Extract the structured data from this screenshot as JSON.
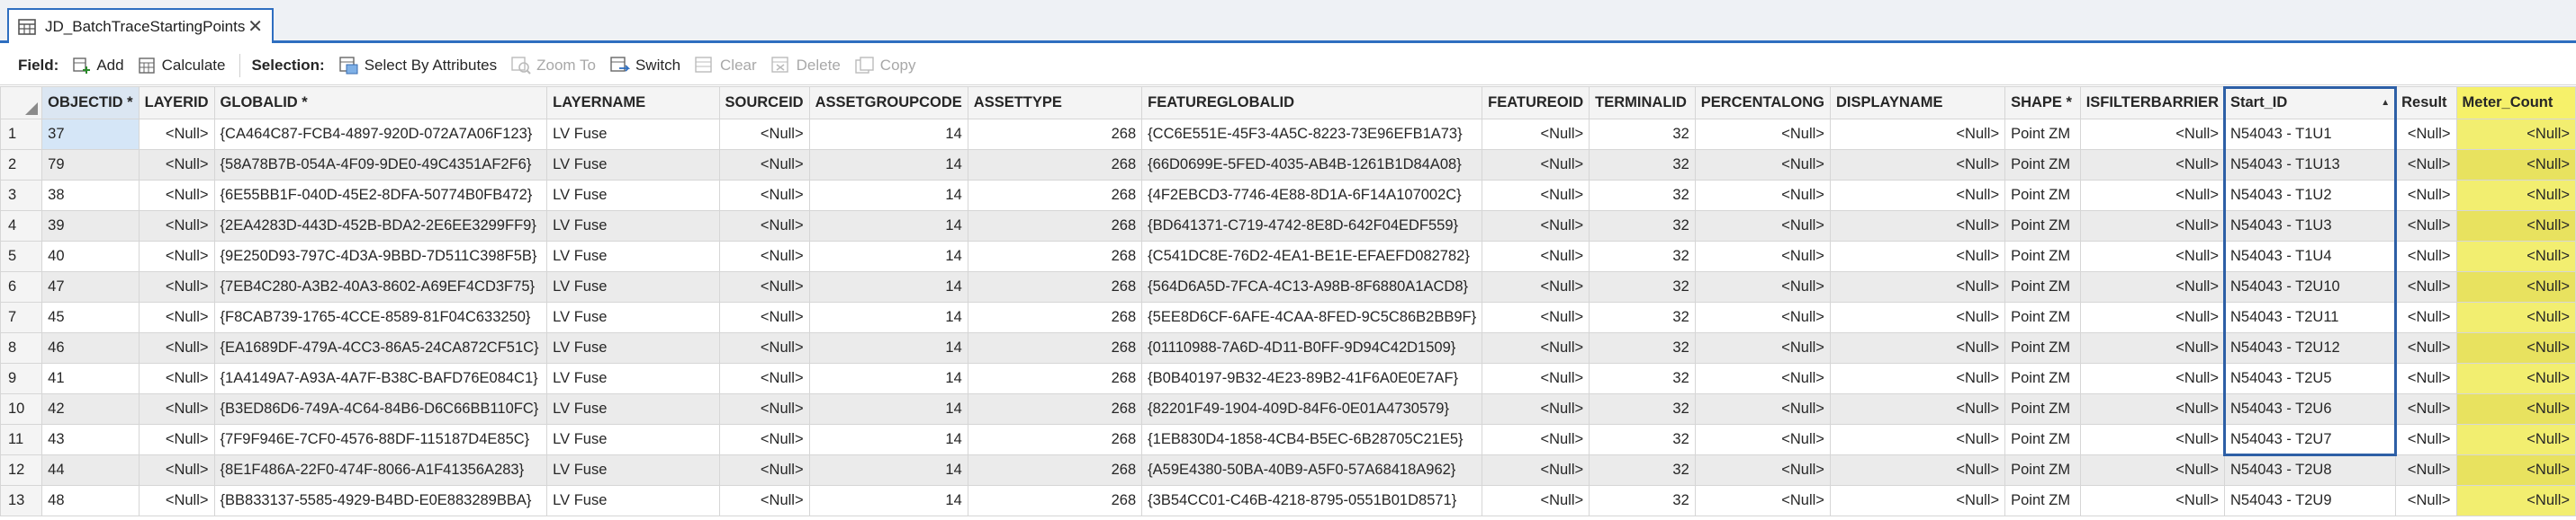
{
  "tab": {
    "title": "JD_BatchTraceStartingPoints",
    "close": "✕"
  },
  "toolbar": {
    "field_label": "Field:",
    "add": "Add",
    "calculate": "Calculate",
    "selection_label": "Selection:",
    "select_by_attributes": "Select By Attributes",
    "zoom_to": "Zoom To",
    "switch": "Switch",
    "clear": "Clear",
    "delete": "Delete",
    "copy": "Copy"
  },
  "columns": [
    "OBJECTID *",
    "LAYERID",
    "GLOBALID *",
    "LAYERNAME",
    "SOURCEID",
    "ASSETGROUPCODE",
    "ASSETTYPE",
    "FEATUREGLOBALID",
    "FEATUREOID",
    "TERMINALID",
    "PERCENTALONG",
    "DISPLAYNAME",
    "SHAPE *",
    "ISFILTERBARRIER",
    "Start_ID",
    "Result",
    "Meter_Count"
  ],
  "rows": [
    {
      "n": "1",
      "c": [
        "37",
        "<Null>",
        "{CA464C87-FCB4-4897-920D-072A7A06F123}",
        "LV Fuse",
        "<Null>",
        "14",
        "268",
        "{CC6E551E-45F3-4A5C-8223-73E96EFB1A73}",
        "<Null>",
        "32",
        "<Null>",
        "<Null>",
        "Point ZM",
        "<Null>",
        "N54043 - T1U1",
        "<Null>",
        "<Null>"
      ]
    },
    {
      "n": "2",
      "c": [
        "79",
        "<Null>",
        "{58A78B7B-054A-4F09-9DE0-49C4351AF2F6}",
        "LV Fuse",
        "<Null>",
        "14",
        "268",
        "{66D0699E-5FED-4035-AB4B-1261B1D84A08}",
        "<Null>",
        "32",
        "<Null>",
        "<Null>",
        "Point ZM",
        "<Null>",
        "N54043 - T1U13",
        "<Null>",
        "<Null>"
      ]
    },
    {
      "n": "3",
      "c": [
        "38",
        "<Null>",
        "{6E55BB1F-040D-45E2-8DFA-50774B0FB472}",
        "LV Fuse",
        "<Null>",
        "14",
        "268",
        "{4F2EBCD3-7746-4E88-8D1A-6F14A107002C}",
        "<Null>",
        "32",
        "<Null>",
        "<Null>",
        "Point ZM",
        "<Null>",
        "N54043 - T1U2",
        "<Null>",
        "<Null>"
      ]
    },
    {
      "n": "4",
      "c": [
        "39",
        "<Null>",
        "{2EA4283D-443D-452B-BDA2-2E6EE3299FF9}",
        "LV Fuse",
        "<Null>",
        "14",
        "268",
        "{BD641371-C719-4742-8E8D-642F04EDF559}",
        "<Null>",
        "32",
        "<Null>",
        "<Null>",
        "Point ZM",
        "<Null>",
        "N54043 - T1U3",
        "<Null>",
        "<Null>"
      ]
    },
    {
      "n": "5",
      "c": [
        "40",
        "<Null>",
        "{9E250D93-797C-4D3A-9BBD-7D511C398F5B}",
        "LV Fuse",
        "<Null>",
        "14",
        "268",
        "{C541DC8E-76D2-4EA1-BE1E-EFAEFD082782}",
        "<Null>",
        "32",
        "<Null>",
        "<Null>",
        "Point ZM",
        "<Null>",
        "N54043 - T1U4",
        "<Null>",
        "<Null>"
      ]
    },
    {
      "n": "6",
      "c": [
        "47",
        "<Null>",
        "{7EB4C280-A3B2-40A3-8602-A69EF4CD3F75}",
        "LV Fuse",
        "<Null>",
        "14",
        "268",
        "{564D6A5D-7FCA-4C13-A98B-8F6880A1ACD8}",
        "<Null>",
        "32",
        "<Null>",
        "<Null>",
        "Point ZM",
        "<Null>",
        "N54043 - T2U10",
        "<Null>",
        "<Null>"
      ]
    },
    {
      "n": "7",
      "c": [
        "45",
        "<Null>",
        "{F8CAB739-1765-4CCE-8589-81F04C633250}",
        "LV Fuse",
        "<Null>",
        "14",
        "268",
        "{5EE8D6CF-6AFE-4CAA-8FED-9C5C86B2BB9F}",
        "<Null>",
        "32",
        "<Null>",
        "<Null>",
        "Point ZM",
        "<Null>",
        "N54043 - T2U11",
        "<Null>",
        "<Null>"
      ]
    },
    {
      "n": "8",
      "c": [
        "46",
        "<Null>",
        "{EA1689DF-479A-4CC3-86A5-24CA872CF51C}",
        "LV Fuse",
        "<Null>",
        "14",
        "268",
        "{01110988-7A6D-4D11-B0FF-9D94C42D1509}",
        "<Null>",
        "32",
        "<Null>",
        "<Null>",
        "Point ZM",
        "<Null>",
        "N54043 - T2U12",
        "<Null>",
        "<Null>"
      ]
    },
    {
      "n": "9",
      "c": [
        "41",
        "<Null>",
        "{1A4149A7-A93A-4A7F-B38C-BAFD76E084C1}",
        "LV Fuse",
        "<Null>",
        "14",
        "268",
        "{B0B40197-9B32-4E23-89B2-41F6A0E0E7AF}",
        "<Null>",
        "32",
        "<Null>",
        "<Null>",
        "Point ZM",
        "<Null>",
        "N54043 - T2U5",
        "<Null>",
        "<Null>"
      ]
    },
    {
      "n": "10",
      "c": [
        "42",
        "<Null>",
        "{B3ED86D6-749A-4C64-84B6-D6C66BB110FC}",
        "LV Fuse",
        "<Null>",
        "14",
        "268",
        "{82201F49-1904-409D-84F6-0E01A4730579}",
        "<Null>",
        "32",
        "<Null>",
        "<Null>",
        "Point ZM",
        "<Null>",
        "N54043 - T2U6",
        "<Null>",
        "<Null>"
      ]
    },
    {
      "n": "11",
      "c": [
        "43",
        "<Null>",
        "{7F9F946E-7CF0-4576-88DF-115187D4E85C}",
        "LV Fuse",
        "<Null>",
        "14",
        "268",
        "{1EB830D4-1858-4CB4-B5EC-6B28705C21E5}",
        "<Null>",
        "32",
        "<Null>",
        "<Null>",
        "Point ZM",
        "<Null>",
        "N54043 - T2U7",
        "<Null>",
        "<Null>"
      ]
    },
    {
      "n": "12",
      "c": [
        "44",
        "<Null>",
        "{8E1F486A-22F0-474F-8066-A1F41356A283}",
        "LV Fuse",
        "<Null>",
        "14",
        "268",
        "{A59E4380-50BA-40B9-A5F0-57A68418A962}",
        "<Null>",
        "32",
        "<Null>",
        "<Null>",
        "Point ZM",
        "<Null>",
        "N54043 - T2U8",
        "<Null>",
        "<Null>"
      ]
    },
    {
      "n": "13",
      "c": [
        "48",
        "<Null>",
        "{BB833137-5585-4929-B4BD-E0E883289BBA}",
        "LV Fuse",
        "<Null>",
        "14",
        "268",
        "{3B54CC01-C46B-4218-8795-0551B01D8571}",
        "<Null>",
        "32",
        "<Null>",
        "<Null>",
        "Point ZM",
        "<Null>",
        "N54043 - T2U9",
        "<Null>",
        "<Null>"
      ]
    }
  ],
  "colors": {
    "accent": "#2e6ec0",
    "highlight": "#f2ee70",
    "selection": "#d5e6f7"
  }
}
